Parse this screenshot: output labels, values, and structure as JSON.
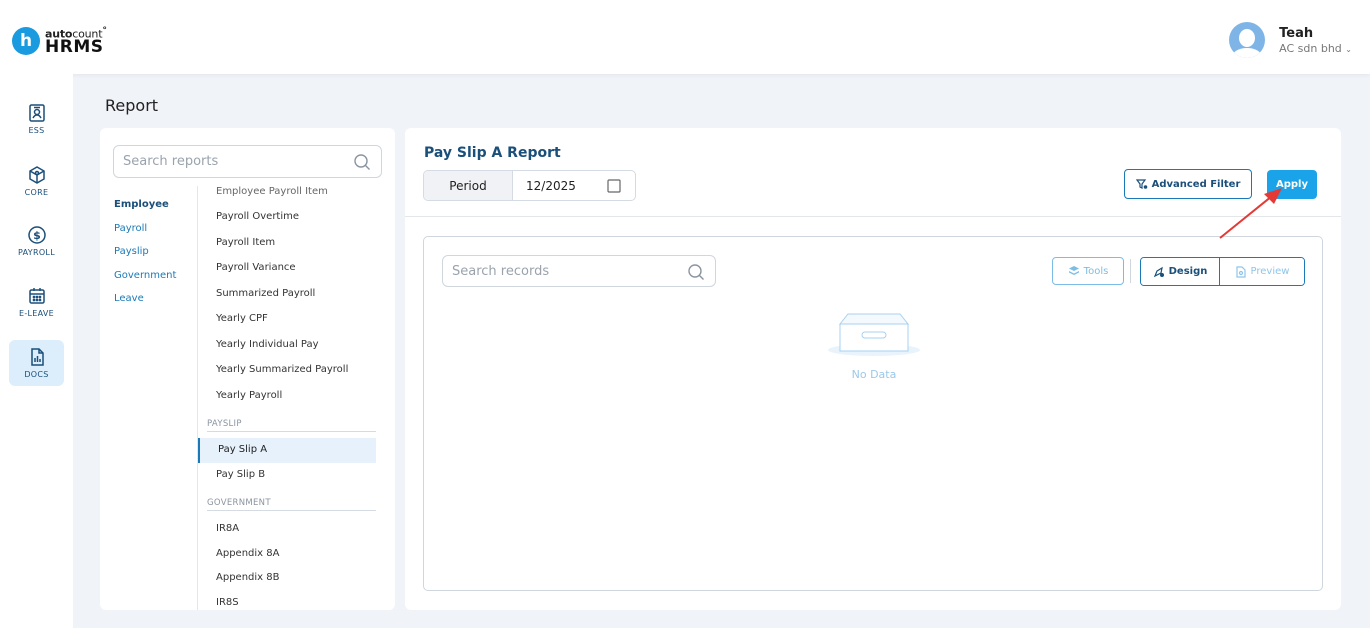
{
  "header": {
    "logo_letter": "h",
    "logo_top_bold": "auto",
    "logo_top_light": "count",
    "logo_mark": "°",
    "logo_bottom": "HRMS",
    "user_name": "Teah",
    "user_company": "AC sdn bhd"
  },
  "sidebar": {
    "items": [
      {
        "label": "ESS",
        "icon": "id-card-icon"
      },
      {
        "label": "CORE",
        "icon": "cube-icon"
      },
      {
        "label": "PAYROLL",
        "icon": "dollar-icon"
      },
      {
        "label": "E-LEAVE",
        "icon": "calendar-icon"
      },
      {
        "label": "DOCS",
        "icon": "document-chart-icon"
      }
    ]
  },
  "page": {
    "title": "Report"
  },
  "left_panel": {
    "search_placeholder": "Search reports",
    "categories": [
      "Employee",
      "Payroll",
      "Payslip",
      "Government",
      "Leave"
    ],
    "partial_top": "Employee Payroll Item",
    "payroll_items": [
      "Payroll Overtime",
      "Payroll Item",
      "Payroll Variance",
      "Summarized Payroll",
      "Yearly CPF",
      "Yearly Individual Pay",
      "Yearly Summarized Payroll",
      "Yearly Payroll"
    ],
    "payslip_header": "PAYSLIP",
    "payslip_items": [
      "Pay Slip A",
      "Pay Slip B"
    ],
    "government_header": "GOVERNMENT",
    "government_items": [
      "IR8A",
      "Appendix 8A",
      "Appendix 8B",
      "IR8S"
    ]
  },
  "main": {
    "report_title": "Pay Slip A Report",
    "period_label": "Period",
    "period_value": "12/2025",
    "advanced_filter_label": "Advanced Filter",
    "apply_label": "Apply",
    "records_search_placeholder": "Search records",
    "tools_label": "Tools",
    "design_label": "Design",
    "preview_label": "Preview",
    "no_data_text": "No Data"
  },
  "colors": {
    "brand_blue": "#1aa3e8",
    "dark_blue": "#1a4f7a",
    "link_blue": "#1a7ab8",
    "annotation_red": "#e53935"
  }
}
